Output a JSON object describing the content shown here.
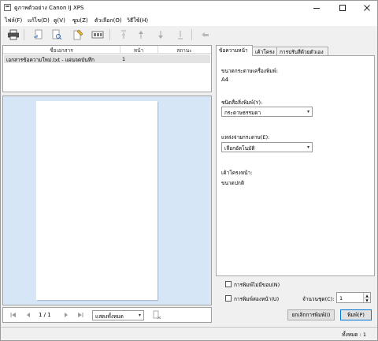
{
  "window": {
    "title": "ดูภาพตัวอย่าง Canon IJ XPS",
    "minimize_icon": "minimize-icon",
    "maximize_icon": "maximize-icon",
    "close_icon": "close-icon"
  },
  "menu": {
    "items": [
      "ไฟล์(F)",
      "แก้ไข(D)",
      "ดู(V)",
      "ซูม(Z)",
      "ตัวเลือก(O)",
      "วิธีใช้(H)"
    ]
  },
  "toolbar": {
    "icons": [
      "print-icon",
      "undo-page-icon",
      "zoom-page-icon",
      "edit-page-icon",
      "thumbnails-icon",
      "move-first-icon",
      "move-up-icon",
      "move-down-icon",
      "move-last-icon",
      "back-icon"
    ]
  },
  "document_list": {
    "headers": [
      "ชื่อเอกสาร",
      "หน้า",
      "สถานะ"
    ],
    "rows": [
      {
        "name": "เอกสารข้อความใหม่.txt - แผ่นจดบันทึก",
        "pages": "1",
        "status": ""
      }
    ]
  },
  "nav": {
    "page_label": "1 / 1",
    "view_option": "แสดงทั้งหมด",
    "colors": {
      "disabled": "#9a9a9a"
    }
  },
  "tabs": [
    "ข้อความหน้า",
    "เค้าโครง",
    "การปรับสีด้วยตัวเอง"
  ],
  "page_settings": {
    "printer_paper_size_label": "ขนาดกระดาษเครื่องพิมพ์:",
    "printer_paper_size_value": "A4",
    "media_type_label": "ชนิดสื่อสิ่งพิมพ์(Y):",
    "media_type_value": "กระดาษธรรมดา",
    "paper_source_label": "แหล่งจ่ายกระดาษ(E):",
    "paper_source_value": "เลือกอัตโนมัติ",
    "layout_label": "เค้าโครงหน้า:",
    "layout_value": "ขนาดปกติ"
  },
  "options": {
    "borderless_label": "การพิมพ์ไม่มีขอบ(N)",
    "duplex_label": "การพิมพ์สองหน้า(U)",
    "copies_label": "จำนวนชุด(C):",
    "copies_value": "1"
  },
  "buttons": {
    "cancel_label": "ยกเลิกการพิมพ์(I)",
    "print_label": "พิมพ์(P)"
  },
  "status": {
    "total_label": "ทั้งหมด : 1"
  },
  "colors": {
    "preview_bg": "#d6e6f7",
    "selected_row": "#e3e3e3",
    "default_button_border": "#0078d7"
  }
}
